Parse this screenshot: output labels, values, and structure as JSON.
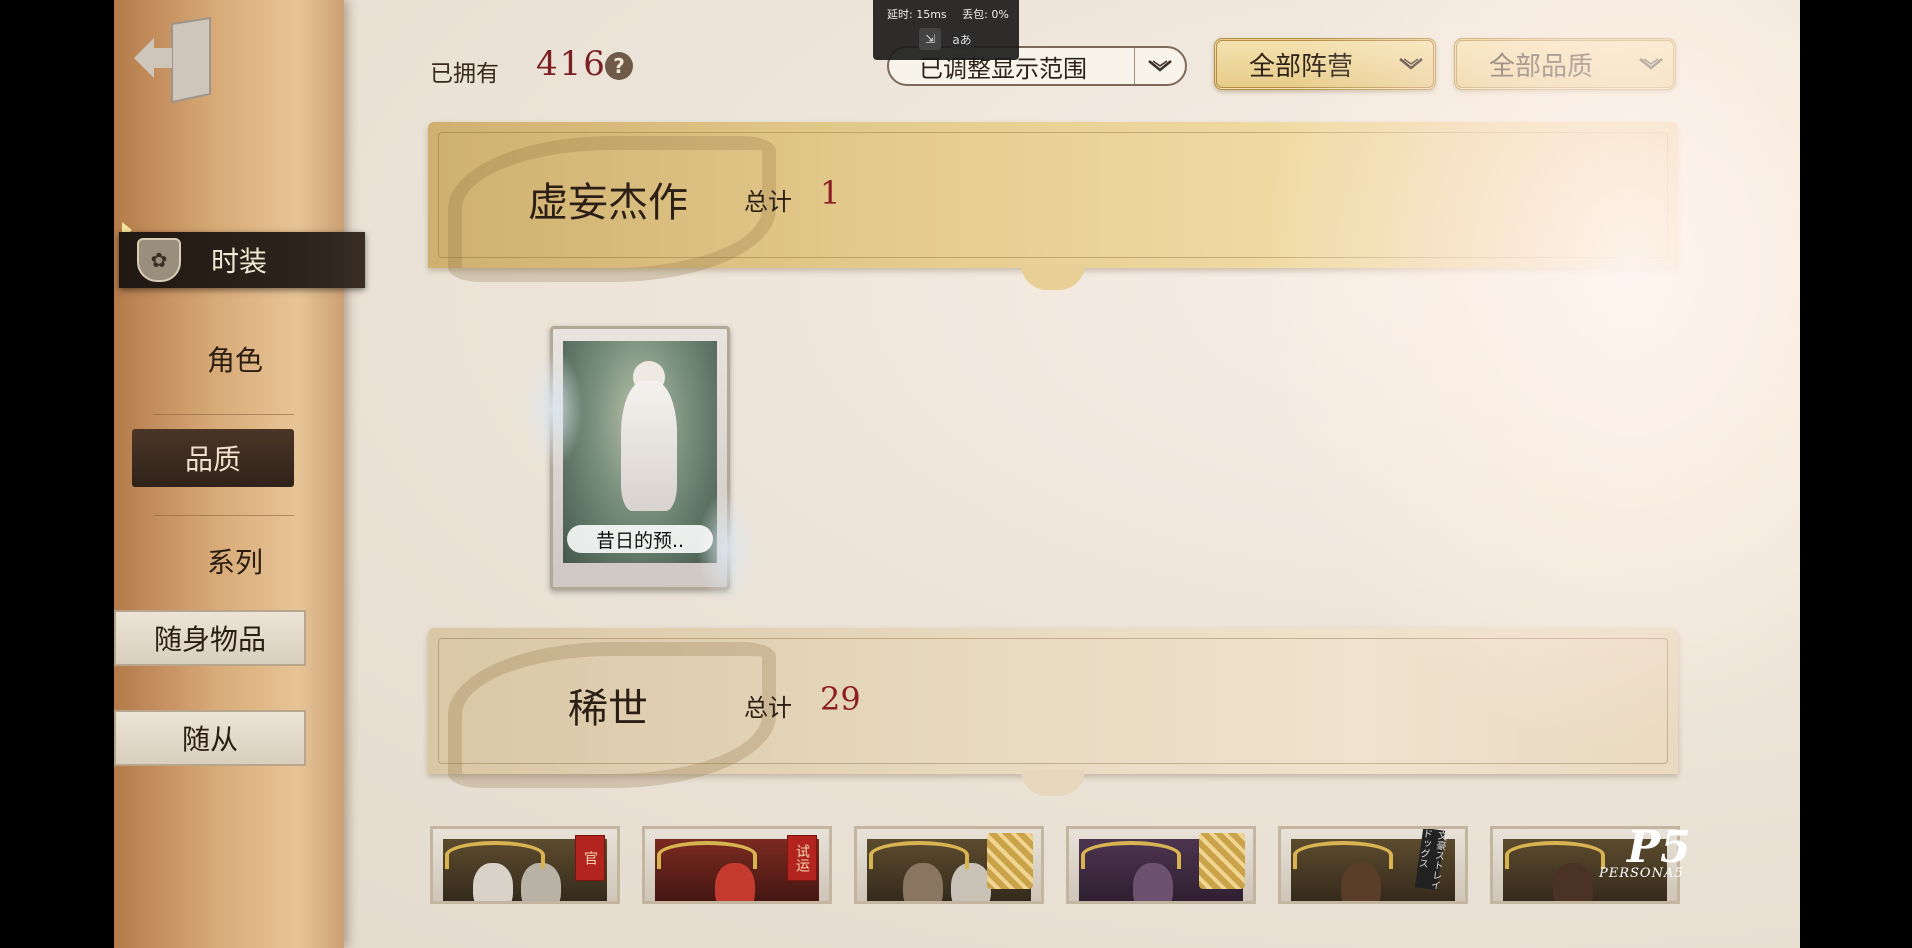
{
  "overlay": {
    "latency": "延时: 15ms",
    "packet_loss": "丢包: 0%",
    "btn_left": "⇲",
    "btn_right": "aあ"
  },
  "sidebar": {
    "active_item": "时装",
    "items": [
      "角色",
      "品质",
      "系列"
    ],
    "box_items": [
      "随身物品",
      "随从"
    ]
  },
  "topbar": {
    "owned_label": "已拥有",
    "owned_count": "416",
    "help": "?",
    "range_dropdown": "已调整显示范围",
    "faction_dropdown": "全部阵营",
    "quality_dropdown": "全部品质"
  },
  "sections": [
    {
      "title": "虚妄杰作",
      "total_label": "总计",
      "total": "1"
    },
    {
      "title": "稀世",
      "total_label": "总计",
      "total": "29"
    }
  ],
  "cards": [
    {
      "label": "昔日的预.."
    }
  ],
  "bottom_cards": [
    {
      "seal": "官"
    },
    {
      "seal": "试运"
    },
    {
      "seal": ""
    },
    {
      "seal": ""
    },
    {
      "ribbon": "文豪ストレイドッグス"
    },
    {
      "seal": ""
    }
  ],
  "logo": {
    "big": "P5",
    "small": "PERSONA5"
  },
  "colors": {
    "accent_red": "#7a1f22",
    "gold": "#e7cc8a",
    "sidebar_dark": "#2e241c"
  }
}
